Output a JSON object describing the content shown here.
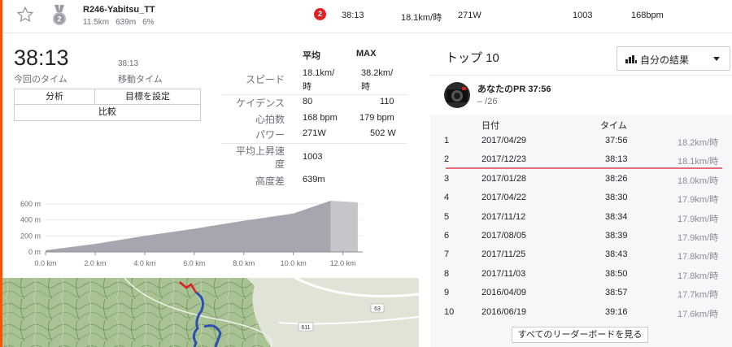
{
  "segment": {
    "name": "R246-Yabitsu_TT",
    "distance": "11.5km",
    "elevation": "639m",
    "grade": "6%",
    "rank": "2",
    "time": "38:13",
    "speed": "18.1km/時",
    "power": "271W",
    "vam": "1003",
    "heartrate": "168bpm"
  },
  "summary": {
    "elapsed_time": "38:13",
    "elapsed_label": "今回のタイム",
    "moving_time": "38:13",
    "moving_label": "移動タイム",
    "buttons": {
      "analysis": "分析",
      "goal": "目標を設定",
      "compare": "比較"
    }
  },
  "stats": {
    "avg_header": "平均",
    "max_header": "MAX",
    "rows": [
      {
        "label": "スピード",
        "avg": "18.1km/時",
        "max": "38.2km/時"
      },
      {
        "label": "ケイデンス",
        "avg": "80",
        "max": "110"
      },
      {
        "label": "心拍数",
        "avg": "168 bpm",
        "max": "179 bpm"
      },
      {
        "label": "パワー",
        "avg": "271W",
        "max": "502 W"
      },
      {
        "label": "平均上昇速度",
        "avg": "1003",
        "max": ""
      },
      {
        "label": "高度差",
        "avg": "639m",
        "max": ""
      }
    ]
  },
  "chart_data": {
    "type": "area",
    "x": [
      0,
      2,
      4,
      6,
      8,
      10,
      11.5,
      12.6
    ],
    "y": [
      20,
      100,
      200,
      290,
      390,
      480,
      640,
      620
    ],
    "x_tick_labels": [
      "0.0 km",
      "2.0 km",
      "4.0 km",
      "6.0 km",
      "8.0 km",
      "10.0 km",
      "12.0 km"
    ],
    "y_tick_labels": [
      "600 m",
      "400 m",
      "200 m",
      "0 m"
    ],
    "xlim": [
      0,
      12.8
    ],
    "ylim": [
      0,
      650
    ],
    "grid": true
  },
  "map": {
    "road_labels": [
      "63",
      "611"
    ]
  },
  "top10": {
    "title": "トップ 10",
    "filter_label": "自分の結果",
    "pr_title": "あなたのPR 37:56",
    "pr_sub": "– /26",
    "col_date": "日付",
    "col_time": "タイム",
    "rows": [
      {
        "rank": "1",
        "date": "2017/04/29",
        "time": "37:56",
        "speed": "18.2km/時"
      },
      {
        "rank": "2",
        "date": "2017/12/23",
        "time": "38:13",
        "speed": "18.1km/時"
      },
      {
        "rank": "3",
        "date": "2017/01/28",
        "time": "38:26",
        "speed": "18.0km/時"
      },
      {
        "rank": "4",
        "date": "2017/04/22",
        "time": "38:30",
        "speed": "17.9km/時"
      },
      {
        "rank": "5",
        "date": "2017/11/12",
        "time": "38:34",
        "speed": "17.9km/時"
      },
      {
        "rank": "6",
        "date": "2017/08/05",
        "time": "38:39",
        "speed": "17.9km/時"
      },
      {
        "rank": "7",
        "date": "2017/11/25",
        "time": "38:43",
        "speed": "17.8km/時"
      },
      {
        "rank": "8",
        "date": "2017/11/03",
        "time": "38:50",
        "speed": "17.8km/時"
      },
      {
        "rank": "9",
        "date": "2016/04/09",
        "time": "38:57",
        "speed": "17.7km/時"
      },
      {
        "rank": "10",
        "date": "2016/06/19",
        "time": "39:16",
        "speed": "17.6km/時"
      }
    ],
    "all_button": "すべてのリーダーボードを見る"
  },
  "colors": {
    "accent": "#fc5200",
    "badge": "#e0201f",
    "highlight_line": "#e86a7a",
    "route": "#2f4fb0",
    "route_start": "#e0201f"
  }
}
